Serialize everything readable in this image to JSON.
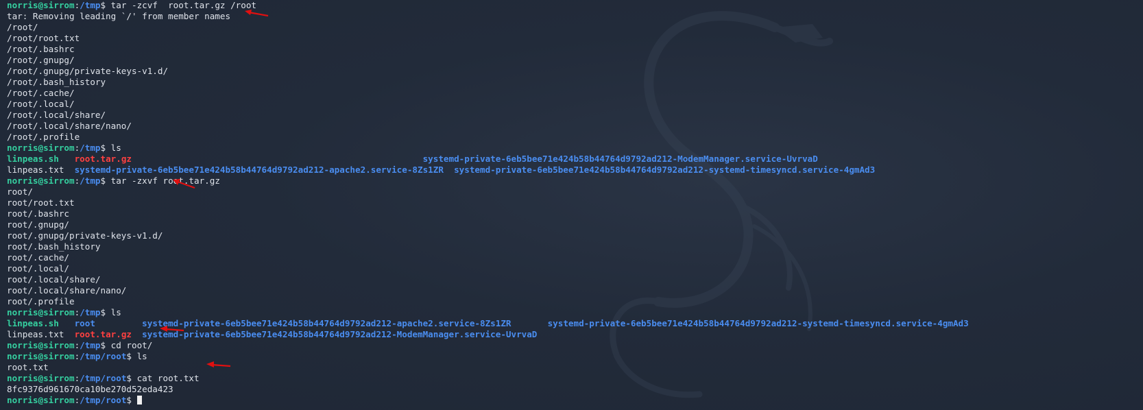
{
  "colors": {
    "background": "#222b3a",
    "user_host": "#35d0a0",
    "path": "#4a8df0",
    "text": "#dfe3ea",
    "archive": "#ff4040",
    "annotation_arrow": "#e01010"
  },
  "terminal": {
    "lines": [
      [
        {
          "t": "norris@sirrom",
          "c": "tok-user"
        },
        {
          "t": ":",
          "c": "tok-text"
        },
        {
          "t": "/tmp",
          "c": "tok-path"
        },
        {
          "t": "$ tar -zcvf  root.tar.gz /root",
          "c": "tok-text"
        }
      ],
      [
        {
          "t": "tar: Removing leading `/' from member names",
          "c": "tok-text"
        }
      ],
      [
        {
          "t": "/root/",
          "c": "tok-text"
        }
      ],
      [
        {
          "t": "/root/root.txt",
          "c": "tok-text"
        }
      ],
      [
        {
          "t": "/root/.bashrc",
          "c": "tok-text"
        }
      ],
      [
        {
          "t": "/root/.gnupg/",
          "c": "tok-text"
        }
      ],
      [
        {
          "t": "/root/.gnupg/private-keys-v1.d/",
          "c": "tok-text"
        }
      ],
      [
        {
          "t": "/root/.bash_history",
          "c": "tok-text"
        }
      ],
      [
        {
          "t": "/root/.cache/",
          "c": "tok-text"
        }
      ],
      [
        {
          "t": "/root/.local/",
          "c": "tok-text"
        }
      ],
      [
        {
          "t": "/root/.local/share/",
          "c": "tok-text"
        }
      ],
      [
        {
          "t": "/root/.local/share/nano/",
          "c": "tok-text"
        }
      ],
      [
        {
          "t": "/root/.profile",
          "c": "tok-text"
        }
      ],
      [
        {
          "t": "norris@sirrom",
          "c": "tok-user"
        },
        {
          "t": ":",
          "c": "tok-text"
        },
        {
          "t": "/tmp",
          "c": "tok-path"
        },
        {
          "t": "$ ls",
          "c": "tok-text"
        }
      ],
      [
        {
          "t": "linpeas.sh",
          "c": "tok-exec"
        },
        {
          "t": "   ",
          "c": "tok-text"
        },
        {
          "t": "root.tar.gz",
          "c": "tok-archive"
        },
        {
          "t": "                                                        ",
          "c": "tok-text"
        },
        {
          "t": "systemd-private-6eb5bee71e424b58b44764d9792ad212-ModemManager.service-UvrvaD",
          "c": "tok-dir"
        }
      ],
      [
        {
          "t": "linpeas.txt",
          "c": "tok-text"
        },
        {
          "t": "  ",
          "c": "tok-text"
        },
        {
          "t": "systemd-private-6eb5bee71e424b58b44764d9792ad212-apache2.service-8Zs1ZR",
          "c": "tok-dir"
        },
        {
          "t": "  ",
          "c": "tok-text"
        },
        {
          "t": "systemd-private-6eb5bee71e424b58b44764d9792ad212-systemd-timesyncd.service-4gmAd3",
          "c": "tok-dir"
        }
      ],
      [
        {
          "t": "norris@sirrom",
          "c": "tok-user"
        },
        {
          "t": ":",
          "c": "tok-text"
        },
        {
          "t": "/tmp",
          "c": "tok-path"
        },
        {
          "t": "$ tar -zxvf root.tar.gz",
          "c": "tok-text"
        }
      ],
      [
        {
          "t": "root/",
          "c": "tok-text"
        }
      ],
      [
        {
          "t": "root/root.txt",
          "c": "tok-text"
        }
      ],
      [
        {
          "t": "root/.bashrc",
          "c": "tok-text"
        }
      ],
      [
        {
          "t": "root/.gnupg/",
          "c": "tok-text"
        }
      ],
      [
        {
          "t": "root/.gnupg/private-keys-v1.d/",
          "c": "tok-text"
        }
      ],
      [
        {
          "t": "root/.bash_history",
          "c": "tok-text"
        }
      ],
      [
        {
          "t": "root/.cache/",
          "c": "tok-text"
        }
      ],
      [
        {
          "t": "root/.local/",
          "c": "tok-text"
        }
      ],
      [
        {
          "t": "root/.local/share/",
          "c": "tok-text"
        }
      ],
      [
        {
          "t": "root/.local/share/nano/",
          "c": "tok-text"
        }
      ],
      [
        {
          "t": "root/.profile",
          "c": "tok-text"
        }
      ],
      [
        {
          "t": "norris@sirrom",
          "c": "tok-user"
        },
        {
          "t": ":",
          "c": "tok-text"
        },
        {
          "t": "/tmp",
          "c": "tok-path"
        },
        {
          "t": "$ ls",
          "c": "tok-text"
        }
      ],
      [
        {
          "t": "linpeas.sh",
          "c": "tok-exec"
        },
        {
          "t": "   ",
          "c": "tok-text"
        },
        {
          "t": "root",
          "c": "tok-dir"
        },
        {
          "t": "         ",
          "c": "tok-text"
        },
        {
          "t": "systemd-private-6eb5bee71e424b58b44764d9792ad212-apache2.service-8Zs1ZR",
          "c": "tok-dir"
        },
        {
          "t": "       ",
          "c": "tok-text"
        },
        {
          "t": "systemd-private-6eb5bee71e424b58b44764d9792ad212-systemd-timesyncd.service-4gmAd3",
          "c": "tok-dir"
        }
      ],
      [
        {
          "t": "linpeas.txt",
          "c": "tok-text"
        },
        {
          "t": "  ",
          "c": "tok-text"
        },
        {
          "t": "root.tar.gz",
          "c": "tok-archive"
        },
        {
          "t": "  ",
          "c": "tok-text"
        },
        {
          "t": "systemd-private-6eb5bee71e424b58b44764d9792ad212-ModemManager.service-UvrvaD",
          "c": "tok-dir"
        }
      ],
      [
        {
          "t": "norris@sirrom",
          "c": "tok-user"
        },
        {
          "t": ":",
          "c": "tok-text"
        },
        {
          "t": "/tmp",
          "c": "tok-path"
        },
        {
          "t": "$ cd root/",
          "c": "tok-text"
        }
      ],
      [
        {
          "t": "norris@sirrom",
          "c": "tok-user"
        },
        {
          "t": ":",
          "c": "tok-text"
        },
        {
          "t": "/tmp/root",
          "c": "tok-path"
        },
        {
          "t": "$ ls",
          "c": "tok-text"
        }
      ],
      [
        {
          "t": "root.txt",
          "c": "tok-text"
        }
      ],
      [
        {
          "t": "norris@sirrom",
          "c": "tok-user"
        },
        {
          "t": ":",
          "c": "tok-text"
        },
        {
          "t": "/tmp/root",
          "c": "tok-path"
        },
        {
          "t": "$ cat root.txt",
          "c": "tok-text"
        }
      ],
      [
        {
          "t": "8fc9376d961670ca10be270d52eda423",
          "c": "tok-text"
        }
      ],
      [
        {
          "t": "norris@sirrom",
          "c": "tok-user"
        },
        {
          "t": ":",
          "c": "tok-text"
        },
        {
          "t": "/tmp/root",
          "c": "tok-path"
        },
        {
          "t": "$ ",
          "c": "tok-text"
        }
      ]
    ]
  }
}
